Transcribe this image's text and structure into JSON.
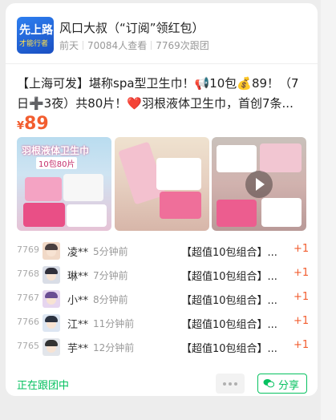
{
  "header": {
    "avatar_text_1": "先上路",
    "avatar_text_2": "才能行者",
    "title": "风口大叔（“订阅”领红包）",
    "time": "前天",
    "views": "70084人查看",
    "followers": "7769次跟团"
  },
  "post": {
    "description": "【上海可发】堪称spa型卫生巾！📢10包💰89！（7日➕3夜）共80片！❤️羽根液体卫生巾，首创7条...",
    "price_symbol": "¥",
    "price": "89",
    "image1_title": "羽根液体卫生巾",
    "image1_subtitle": "10包80片",
    "image3_has_video": true
  },
  "orders": [
    {
      "num": "7769",
      "name": "凌**",
      "time": "5分钟前",
      "product": "【超值10包组合】...",
      "qty": "+1"
    },
    {
      "num": "7768",
      "name": "琳**",
      "time": "7分钟前",
      "product": "【超值10包组合】...",
      "qty": "+1"
    },
    {
      "num": "7767",
      "name": "小**",
      "time": "8分钟前",
      "product": "【超值10包组合】...",
      "qty": "+1"
    },
    {
      "num": "7766",
      "name": "江**",
      "time": "11分钟前",
      "product": "【超值10包组合】...",
      "qty": "+1"
    },
    {
      "num": "7765",
      "name": "芋**",
      "time": "12分钟前",
      "product": "【超值10包组合】...",
      "qty": "+1"
    }
  ],
  "footer": {
    "status": "正在跟团中",
    "share_label": "分享"
  },
  "colors": {
    "accent_green": "#07c160",
    "price_orange": "#f25d2f"
  }
}
